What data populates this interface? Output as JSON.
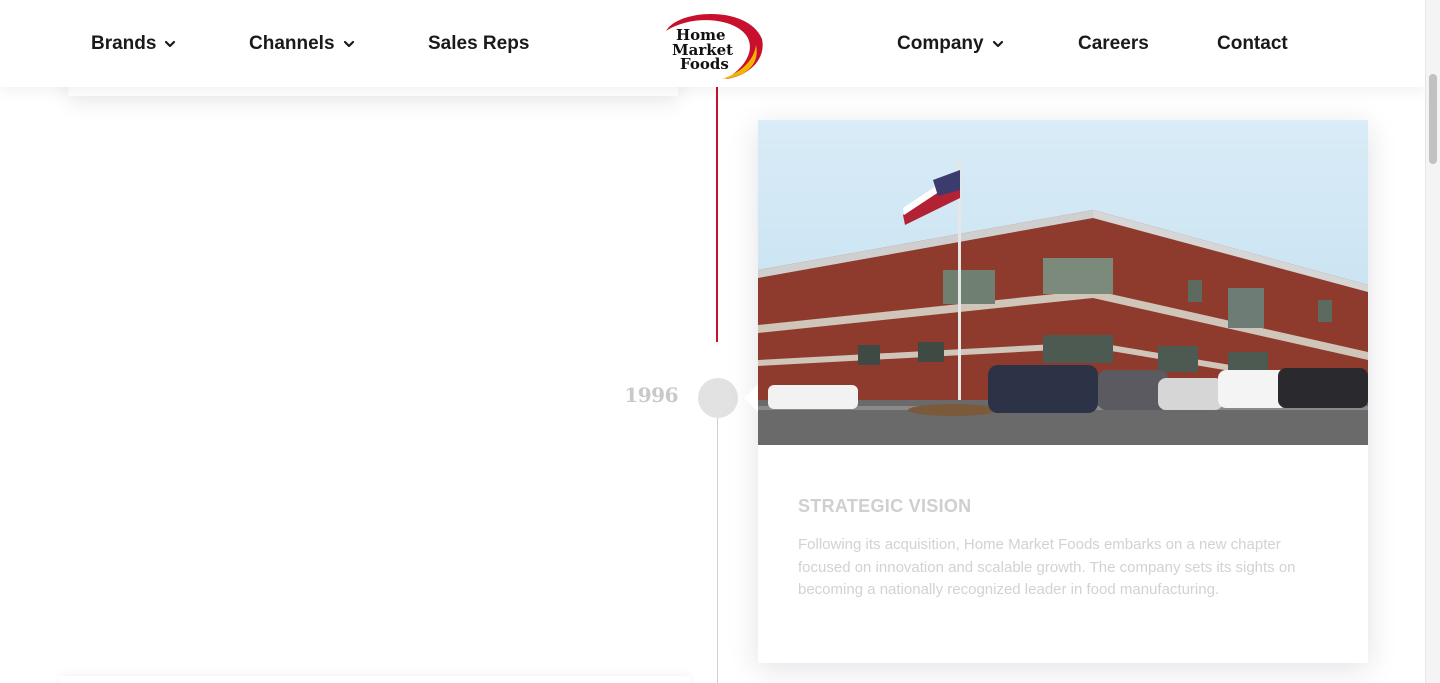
{
  "nav": {
    "left": [
      {
        "label": "Brands",
        "has_dropdown": true
      },
      {
        "label": "Channels",
        "has_dropdown": true
      },
      {
        "label": "Sales Reps",
        "has_dropdown": false
      }
    ],
    "right": [
      {
        "label": "Company",
        "has_dropdown": true
      },
      {
        "label": "Careers",
        "has_dropdown": false
      },
      {
        "label": "Contact",
        "has_dropdown": false
      }
    ],
    "logo": {
      "line1": "Home",
      "line2": "Market",
      "line3": "Foods"
    }
  },
  "timeline": {
    "year": "1996",
    "card": {
      "image_icon": "building-photo",
      "title": "STRATEGIC VISION",
      "body": "Following its acquisition, Home Market Foods embarks on a new chapter focused on innovation and scalable growth. The company sets its sights on becoming a nationally recognized leader in food manufacturing."
    }
  },
  "colors": {
    "brand_red": "#c8102e",
    "brand_yellow": "#f2b600",
    "nav_text": "#1a1a1a",
    "muted_text": "#d2d2d2"
  }
}
